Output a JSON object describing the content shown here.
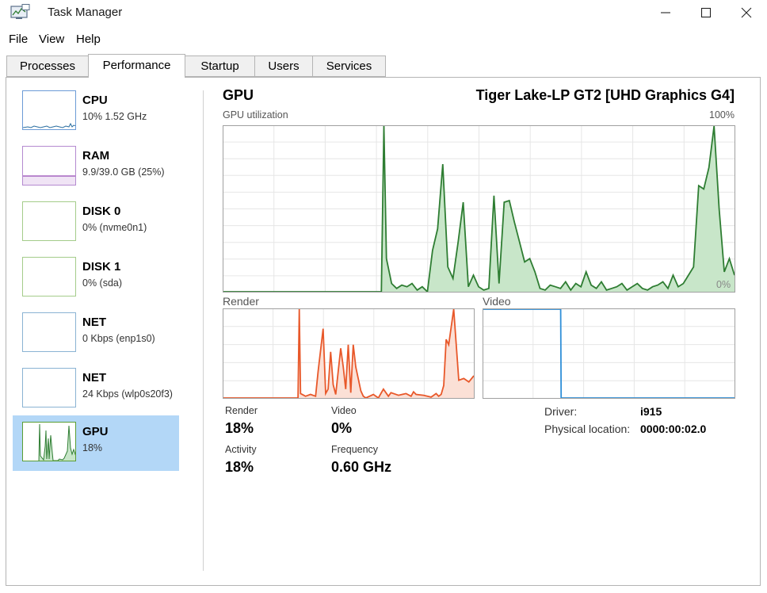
{
  "window": {
    "title": "Task Manager"
  },
  "menu": {
    "file": "File",
    "view": "View",
    "help": "Help"
  },
  "tabs": [
    {
      "label": "Processes"
    },
    {
      "label": "Performance"
    },
    {
      "label": "Startup"
    },
    {
      "label": "Users"
    },
    {
      "label": "Services"
    }
  ],
  "resources": [
    {
      "name": "CPU",
      "sub": "10% 1.52 GHz"
    },
    {
      "name": "RAM",
      "sub": "9.9/39.0 GB (25%)"
    },
    {
      "name": "DISK 0",
      "sub": "0% (nvme0n1)"
    },
    {
      "name": "DISK 1",
      "sub": "0% (sda)"
    },
    {
      "name": "NET",
      "sub": "0 Kbps (enp1s0)"
    },
    {
      "name": "NET",
      "sub": "24 Kbps (wlp0s20f3)"
    },
    {
      "name": "GPU",
      "sub": "18%"
    }
  ],
  "gpu": {
    "title": "GPU",
    "model": "Tiger Lake-LP GT2 [UHD Graphics G4]",
    "utilization_label": "GPU utilization",
    "max_label": "100%",
    "min_label": "0%",
    "render_label": "Render",
    "video_label": "Video",
    "stats": {
      "render_label": "Render",
      "render_value": "18%",
      "video_label": "Video",
      "video_value": "0%",
      "activity_label": "Activity",
      "activity_value": "18%",
      "frequency_label": "Frequency",
      "frequency_value": "0.60 GHz"
    },
    "info": {
      "driver_label": "Driver:",
      "driver_value": "i915",
      "location_label": "Physical location:",
      "location_value": "0000:00:02.0"
    }
  },
  "colors": {
    "gpu_line": "#2e7d32",
    "gpu_fill": "#c8e6c9",
    "render_line": "#e8582a",
    "render_fill": "#fbe0d6",
    "video_line": "#2f8fd8",
    "grid": "#e6e6e6",
    "ram_line": "#7b1fa2",
    "disk_line": "#5a9e34",
    "net_line": "#2a6ea0",
    "cpu_line": "#2a6ea0",
    "selected": "#b3d7f7"
  },
  "chart_data": [
    {
      "type": "area",
      "title": "GPU utilization",
      "ylim": [
        0,
        100
      ],
      "x": [
        0,
        31,
        31.5,
        32,
        33,
        34,
        35,
        36,
        37,
        38,
        39,
        40,
        41,
        42,
        43,
        44,
        45,
        46,
        47,
        48,
        49,
        50,
        51,
        52,
        53,
        54,
        55,
        56,
        57,
        58,
        59,
        60,
        61,
        62,
        63,
        64,
        65,
        66,
        67,
        68,
        69,
        70,
        71,
        72,
        73,
        74,
        75,
        76,
        77,
        78,
        79,
        80,
        81,
        82,
        83,
        84,
        85,
        86,
        87,
        88,
        89,
        90,
        91,
        92,
        93,
        94,
        95,
        96,
        97,
        98,
        99,
        100
      ],
      "y": [
        0,
        0,
        100,
        20,
        5,
        2,
        4,
        3,
        5,
        1,
        3,
        0,
        25,
        38,
        77,
        15,
        8,
        30,
        54,
        3,
        10,
        3,
        1,
        2,
        58,
        5,
        54,
        55,
        42,
        30,
        18,
        20,
        12,
        2,
        1,
        4,
        3,
        2,
        6,
        1,
        5,
        3,
        12,
        4,
        2,
        6,
        1,
        2,
        3,
        5,
        1,
        3,
        5,
        2,
        1,
        3,
        4,
        6,
        2,
        10,
        3,
        5,
        10,
        15,
        64,
        62,
        75,
        100,
        50,
        12,
        20,
        10,
        18,
        14,
        20,
        12,
        10,
        25,
        20
      ],
      "grid": true
    },
    {
      "type": "area",
      "title": "Render",
      "ylim": [
        0,
        100
      ],
      "x": [
        0,
        30,
        30.5,
        31,
        33,
        35,
        37,
        38,
        40,
        41,
        42,
        43,
        44,
        45,
        47,
        48,
        49,
        50,
        51,
        52,
        53,
        55,
        56,
        57,
        60,
        62,
        64,
        66,
        67,
        70,
        73,
        75,
        76,
        77,
        80,
        83,
        85,
        86,
        87,
        88,
        89,
        90,
        92,
        94,
        96,
        98,
        100
      ],
      "y": [
        0,
        0,
        100,
        5,
        2,
        4,
        2,
        30,
        78,
        5,
        10,
        52,
        15,
        4,
        56,
        35,
        10,
        60,
        6,
        60,
        35,
        8,
        2,
        0,
        4,
        0,
        10,
        2,
        6,
        3,
        5,
        2,
        7,
        4,
        3,
        1,
        5,
        2,
        4,
        14,
        66,
        60,
        100,
        20,
        22,
        18,
        25
      ],
      "grid": true
    },
    {
      "type": "line",
      "title": "Video",
      "ylim": [
        0,
        100
      ],
      "x": [
        0,
        31,
        31.2,
        100
      ],
      "y": [
        100,
        100,
        0,
        0
      ],
      "grid": true
    }
  ]
}
